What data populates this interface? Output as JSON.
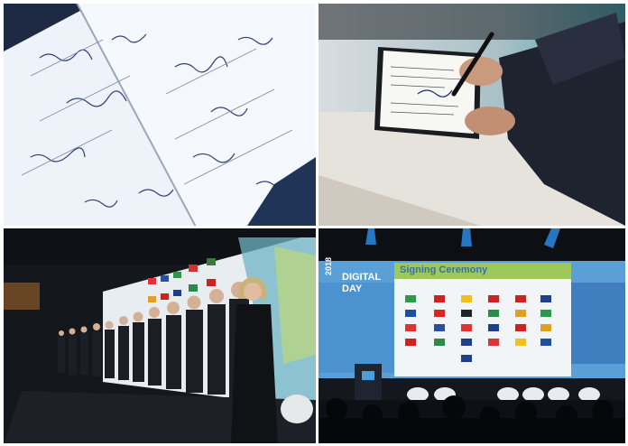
{
  "collage": {
    "panels": [
      {
        "subject": "signed-documents"
      },
      {
        "subject": "hand-signing-document"
      },
      {
        "subject": "delegates-lined-up-on-stage"
      },
      {
        "subject": "stage-with-ceremony-screen"
      }
    ]
  },
  "stage_screen": {
    "event_year": "2018",
    "event_line1": "DIGITAL",
    "event_line2": "DAY",
    "ceremony_title": "Signing Ceremony"
  },
  "colors": {
    "screen_blue": "#4f8fc8",
    "screen_green": "#9cc95a",
    "stage_dark": "#1a1d22",
    "paper": "#eef3fa"
  }
}
